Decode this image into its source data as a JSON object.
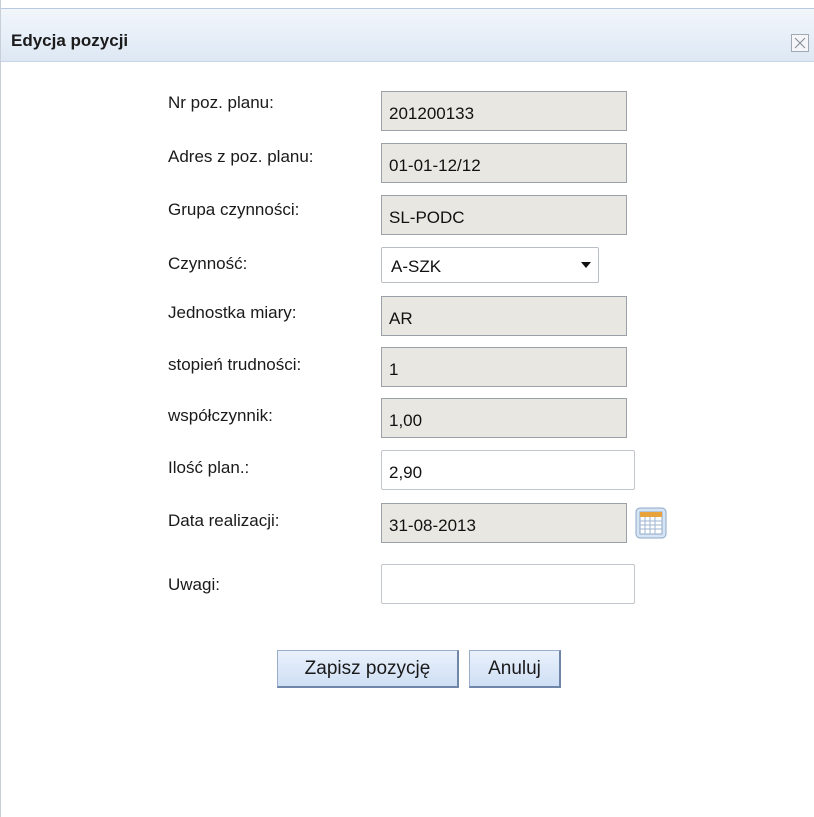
{
  "window": {
    "title": "Edycja pozycji"
  },
  "form": {
    "nr_poz_planu": {
      "label": "Nr poz. planu:",
      "value": "201200133"
    },
    "adres": {
      "label": "Adres z poz. planu:",
      "value": "01-01-12/12"
    },
    "grupa": {
      "label": "Grupa czynności:",
      "value": "SL-PODC"
    },
    "czynnosc": {
      "label": "Czynność:",
      "value": "A-SZK"
    },
    "jednostka": {
      "label": "Jednostka miary:",
      "value": "AR"
    },
    "stopien": {
      "label": "stopień trudności:",
      "value": "1"
    },
    "wspolczynnik": {
      "label": "współczynnik:",
      "value": "1,00"
    },
    "ilosc": {
      "label": "Ilość plan.:",
      "value": "2,90"
    },
    "data": {
      "label": "Data realizacji:",
      "value": "31-08-2013"
    },
    "uwagi": {
      "label": "Uwagi:",
      "value": ""
    }
  },
  "buttons": {
    "save": "Zapisz pozycję",
    "cancel": "Anuluj"
  },
  "icons": {
    "close": "close-icon",
    "calendar": "calendar-icon",
    "dropdown": "chevron-down-icon"
  },
  "colors": {
    "readonly_bg": "#e9e7e1",
    "titlebar": "#dde8f4",
    "button": "#cfdff4"
  }
}
